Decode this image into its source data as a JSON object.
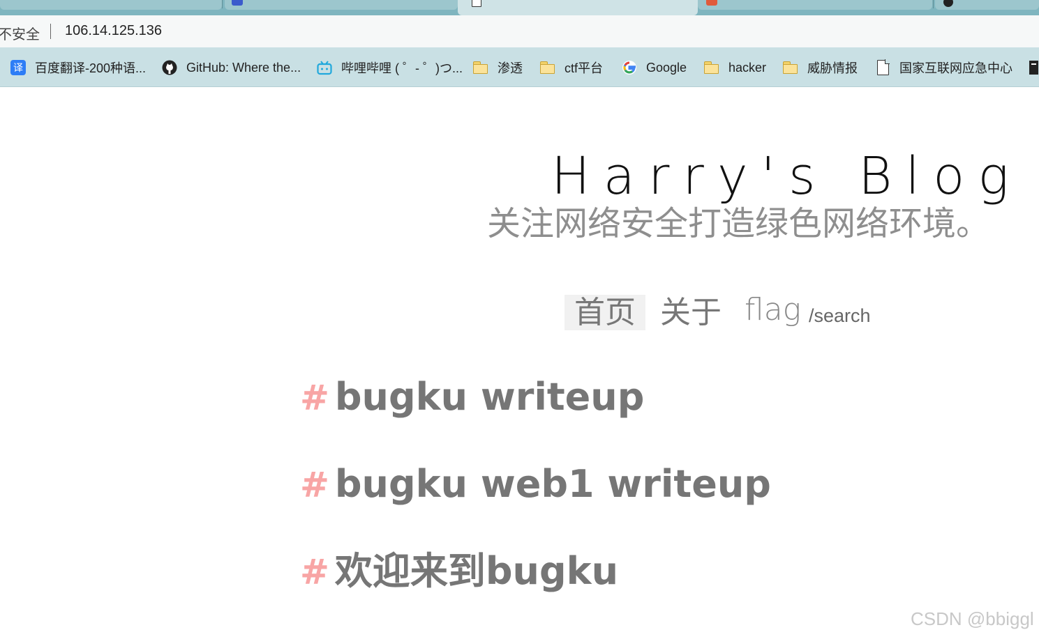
{
  "browser": {
    "address": {
      "security_label": "不安全",
      "url": "106.14.125.136"
    },
    "bookmarks": [
      {
        "label": "百度翻译-200种语...",
        "icon": "baidu-translate-icon"
      },
      {
        "label": "GitHub: Where the...",
        "icon": "github-icon"
      },
      {
        "label": "哔哩哔哩 ( ゜- ゜)つ...",
        "icon": "bilibili-icon"
      },
      {
        "label": "渗透",
        "icon": "folder-icon"
      },
      {
        "label": "ctf平台",
        "icon": "folder-icon"
      },
      {
        "label": "Google",
        "icon": "google-icon"
      },
      {
        "label": "hacker",
        "icon": "folder-icon"
      },
      {
        "label": "威胁情报",
        "icon": "folder-icon"
      },
      {
        "label": "国家互联网应急中心",
        "icon": "document-icon"
      }
    ],
    "colors": {
      "tabstrip": "#7fb5bf",
      "bookmarks_bar": "#c9e0e4",
      "address_bar": "#f6f8f8"
    }
  },
  "blog": {
    "title": "Harry's Blog",
    "subtitle": "关注网络安全打造绿色网络环境。",
    "nav": {
      "home": "首页",
      "about": "关于",
      "flag": "flag",
      "search": "/search"
    },
    "posts": [
      {
        "hash": "#",
        "title": "bugku writeup"
      },
      {
        "hash": "#",
        "title": "bugku web1 writeup"
      },
      {
        "hash": "#",
        "title": "欢迎来到bugku"
      }
    ],
    "colors": {
      "hash": "#f8a5a5",
      "post_title": "#767676",
      "subtitle": "#8e8e8e"
    }
  },
  "watermark": "CSDN @bbiggl"
}
